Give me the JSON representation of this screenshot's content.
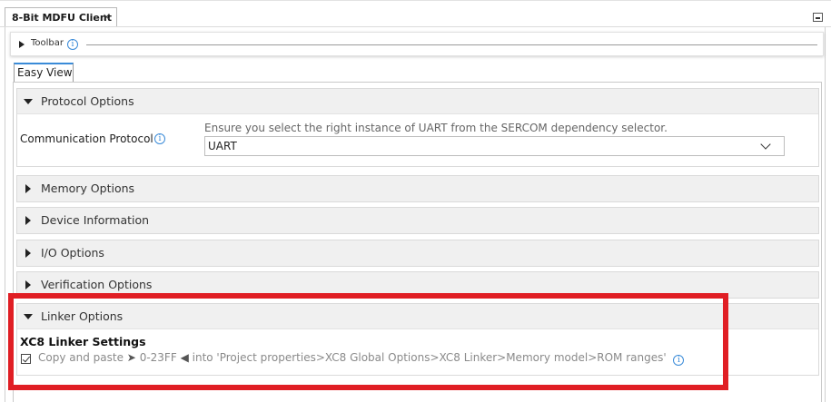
{
  "tab": {
    "title": "8-Bit MDFU Client",
    "close": "×"
  },
  "toolbar": {
    "label": "Toolbar",
    "info": "i"
  },
  "view_tab": {
    "label": "Easy View"
  },
  "sections": {
    "protocol": {
      "title": "Protocol Options",
      "expanded": true,
      "comm_label": "Communication Protocol",
      "info": "i",
      "hint": "Ensure you select the right instance of UART from the SERCOM dependency selector.",
      "selected": "UART"
    },
    "memory": {
      "title": "Memory Options",
      "expanded": false
    },
    "device": {
      "title": "Device Information",
      "expanded": false
    },
    "io": {
      "title": "I/O Options",
      "expanded": false
    },
    "verification": {
      "title": "Verification Options",
      "expanded": false
    },
    "linker": {
      "title": "Linker Options",
      "expanded": true,
      "heading": "XC8 Linker Settings",
      "instr_prefix": "Copy and paste",
      "arrow_right": "➤",
      "value": "0-23FF",
      "arrow_left": "◀",
      "instr_suffix": "into 'Project properties>XC8 Global Options>XC8 Linker>Memory model>ROM ranges'",
      "info": "i"
    }
  },
  "colors": {
    "accent": "#3a8bd8",
    "highlight": "#e01e24",
    "header_bg": "#f0f0f0"
  }
}
